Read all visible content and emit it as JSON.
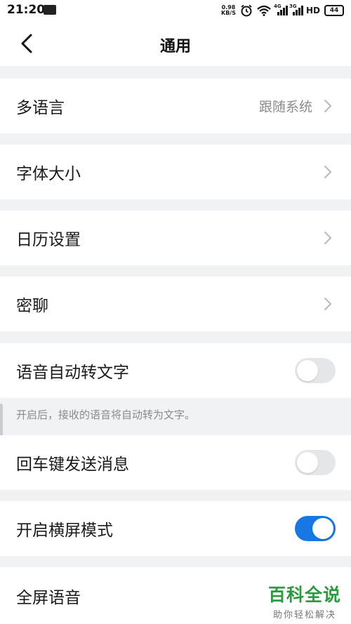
{
  "status_bar": {
    "time": "21:20",
    "net_speed_value": "0.98",
    "net_speed_unit": "KB/S",
    "network_1": "4G",
    "network_2": "3G",
    "hd": "HD",
    "battery": "44"
  },
  "nav": {
    "title": "通用",
    "back_icon": "chevron-left-icon"
  },
  "rows": {
    "language": {
      "label": "多语言",
      "value": "跟随系统"
    },
    "font_size": {
      "label": "字体大小"
    },
    "calendar": {
      "label": "日历设置"
    },
    "secret_chat": {
      "label": "密聊"
    },
    "voice_to_text": {
      "label": "语音自动转文字",
      "enabled": false
    },
    "voice_to_text_hint": "开启后，接收的语音将自动转为文字。",
    "enter_send": {
      "label": "回车键发送消息",
      "enabled": false
    },
    "landscape": {
      "label": "开启横屏模式",
      "enabled": true
    },
    "fullscreen_voice": {
      "label": "全屏语音"
    }
  },
  "watermark": {
    "title": "百科全说",
    "subtitle": "助你轻松解决"
  },
  "colors": {
    "toggle_on": "#1677e5",
    "toggle_off": "#e5e6e8",
    "background": "#f1f2f4",
    "watermark_green": "#2b9b3f"
  }
}
